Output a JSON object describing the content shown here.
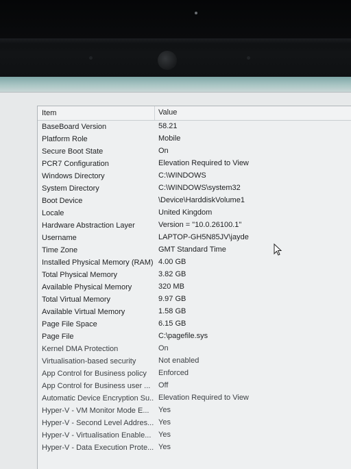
{
  "table": {
    "header": {
      "item": "Item",
      "value": "Value"
    },
    "rows": [
      {
        "item": "BaseBoard Version",
        "value": "58.21"
      },
      {
        "item": "Platform Role",
        "value": "Mobile"
      },
      {
        "item": "Secure Boot State",
        "value": "On"
      },
      {
        "item": "PCR7 Configuration",
        "value": "Elevation Required to View"
      },
      {
        "item": "Windows Directory",
        "value": "C:\\WINDOWS"
      },
      {
        "item": "System Directory",
        "value": "C:\\WINDOWS\\system32"
      },
      {
        "item": "Boot Device",
        "value": "\\Device\\HarddiskVolume1"
      },
      {
        "item": "Locale",
        "value": "United Kingdom"
      },
      {
        "item": "Hardware Abstraction Layer",
        "value": "Version = \"10.0.26100.1\""
      },
      {
        "item": "Username",
        "value": "LAPTOP-GH5N85JV\\jayde"
      },
      {
        "item": "Time Zone",
        "value": "GMT Standard Time"
      },
      {
        "item": "Installed Physical Memory (RAM)",
        "value": "4.00 GB"
      },
      {
        "item": "Total Physical Memory",
        "value": "3.82 GB"
      },
      {
        "item": "Available Physical Memory",
        "value": "320 MB"
      },
      {
        "item": "Total Virtual Memory",
        "value": "9.97 GB"
      },
      {
        "item": "Available Virtual Memory",
        "value": "1.58 GB"
      },
      {
        "item": "Page File Space",
        "value": "6.15 GB"
      },
      {
        "item": "Page File",
        "value": "C:\\pagefile.sys"
      },
      {
        "item": "Kernel DMA Protection",
        "value": "On"
      },
      {
        "item": "Virtualisation-based security",
        "value": "Not enabled"
      },
      {
        "item": "App Control for Business policy",
        "value": "Enforced"
      },
      {
        "item": "App Control for Business user ...",
        "value": "Off"
      },
      {
        "item": "Automatic Device Encryption Su...",
        "value": "Elevation Required to View"
      },
      {
        "item": "Hyper-V - VM Monitor Mode E...",
        "value": "Yes"
      },
      {
        "item": "Hyper-V - Second Level Addres...",
        "value": "Yes"
      },
      {
        "item": "Hyper-V - Virtualisation Enable...",
        "value": "Yes"
      },
      {
        "item": "Hyper-V - Data Execution Prote...",
        "value": "Yes"
      }
    ]
  },
  "icons": {
    "cursor": "mouse-pointer-icon",
    "webcam": "webcam-icon",
    "logo": "laptop-logo-icon"
  }
}
